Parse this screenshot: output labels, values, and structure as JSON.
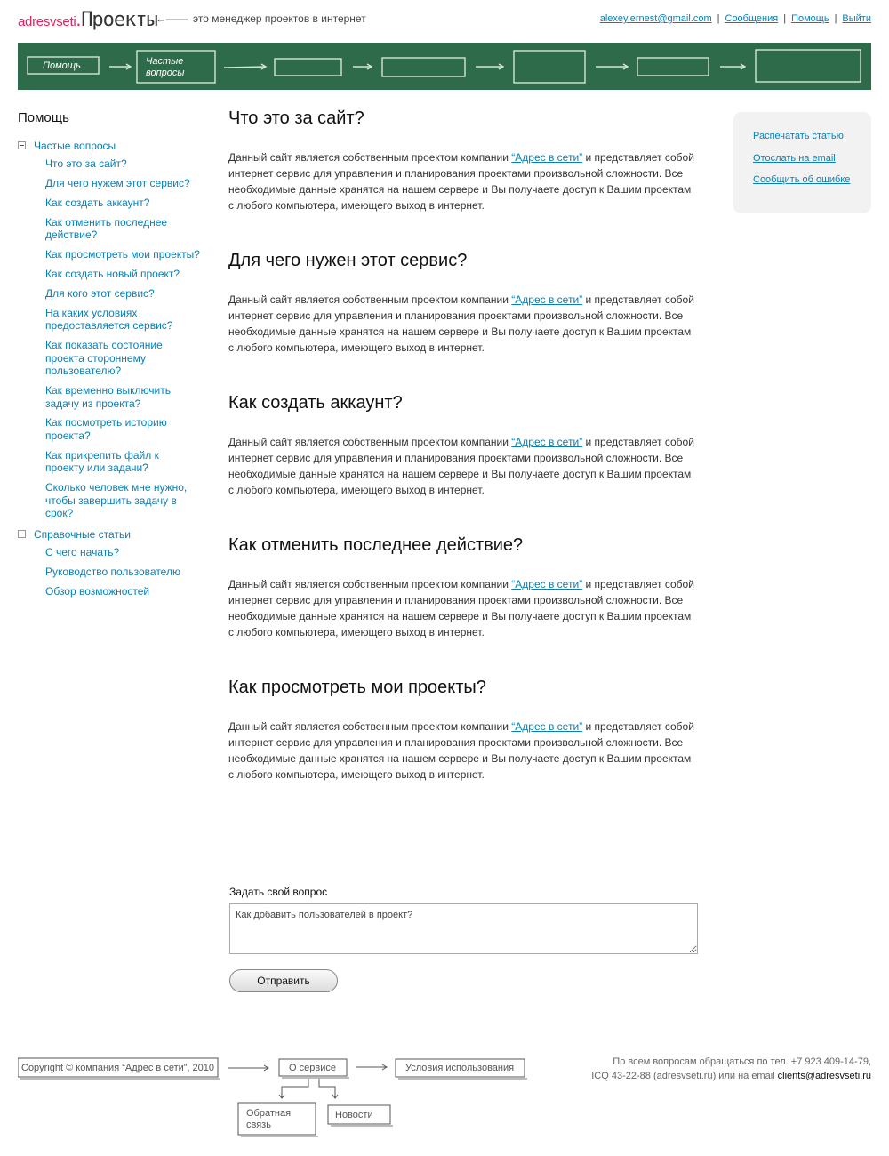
{
  "header": {
    "brand": "adresvseti",
    "dot": ".",
    "app_name": "Проекты",
    "tagline_arrow": "←——",
    "tagline": "это менеджер проектов в интернет",
    "links": [
      "alexey.ernest@gmail.com",
      "Сообщения",
      "Помощь",
      "Выйти"
    ],
    "separator": "|"
  },
  "banner": {
    "steps": [
      "Помощь",
      "Частые вопросы"
    ]
  },
  "sidebar": {
    "title": "Помощь",
    "groups": [
      {
        "label": "Частые вопросы",
        "items": [
          "Что это за сайт?",
          "Для чего нужем этот сервис?",
          "Как создать аккаунт?",
          "Как отменить последнее действие?",
          "Как просмотреть мои проекты?",
          "Как создать новый проект?",
          "Для кого этот сервис?",
          "На каких условиях предоставляется сервис?",
          "Как показать состояние проекта стороннему пользователю?",
          "Как временно выключить задачу из проекта?",
          "Как посмотреть историю проекта?",
          "Как прикрепить файл к проекту или задачи?",
          "Сколько человек мне нужно, чтобы завершить задачу в срок?"
        ]
      },
      {
        "label": "Справочные статьи",
        "items": [
          "С чего начать?",
          "Руководство пользователю",
          "Обзор возможностей"
        ]
      }
    ]
  },
  "article": {
    "sections": [
      {
        "title": "Что это за сайт?"
      },
      {
        "title": "Для чего нужен этот сервис?"
      },
      {
        "title": "Как создать аккаунт?"
      },
      {
        "title": "Как отменить последнее действие?"
      },
      {
        "title": "Как просмотреть мои проекты?"
      }
    ],
    "text_before": "Данный сайт является собственным проектом компании ",
    "link": "“Адрес в сети”",
    "text_after": " и представляет собой интернет сервис для управления и планирования проектами произвольной сложности. Все необходимые данные хранятся на нашем сервере и Вы получаете доступ к Вашим проектам с любого компьютера, имеющего выход в интернет."
  },
  "actions": [
    "Распечатать статью",
    "Отослать на email",
    "Сообщить об ошибке"
  ],
  "question": {
    "label": "Задать свой вопрос",
    "value": "Как добавить пользователей в проект?",
    "submit": "Отправить"
  },
  "footer": {
    "copyright": "Copyright © компания “Адрес в сети”, 2010",
    "about": "О сервисе",
    "terms": "Условия использования",
    "feedback": "Обратная связь",
    "news": "Новости",
    "contact_line1": "По всем вопросам обращаться по тел. +7 923 409-14-79,",
    "contact_line2": "ICQ 43-22-88 (adresvseti.ru) или на email ",
    "contact_email": "clients@adresvseti.ru"
  },
  "colors": {
    "brand": "#e0245e",
    "link": "#0a7fb3",
    "board": "#2e6b4b",
    "panel": "#f2f2f2"
  }
}
